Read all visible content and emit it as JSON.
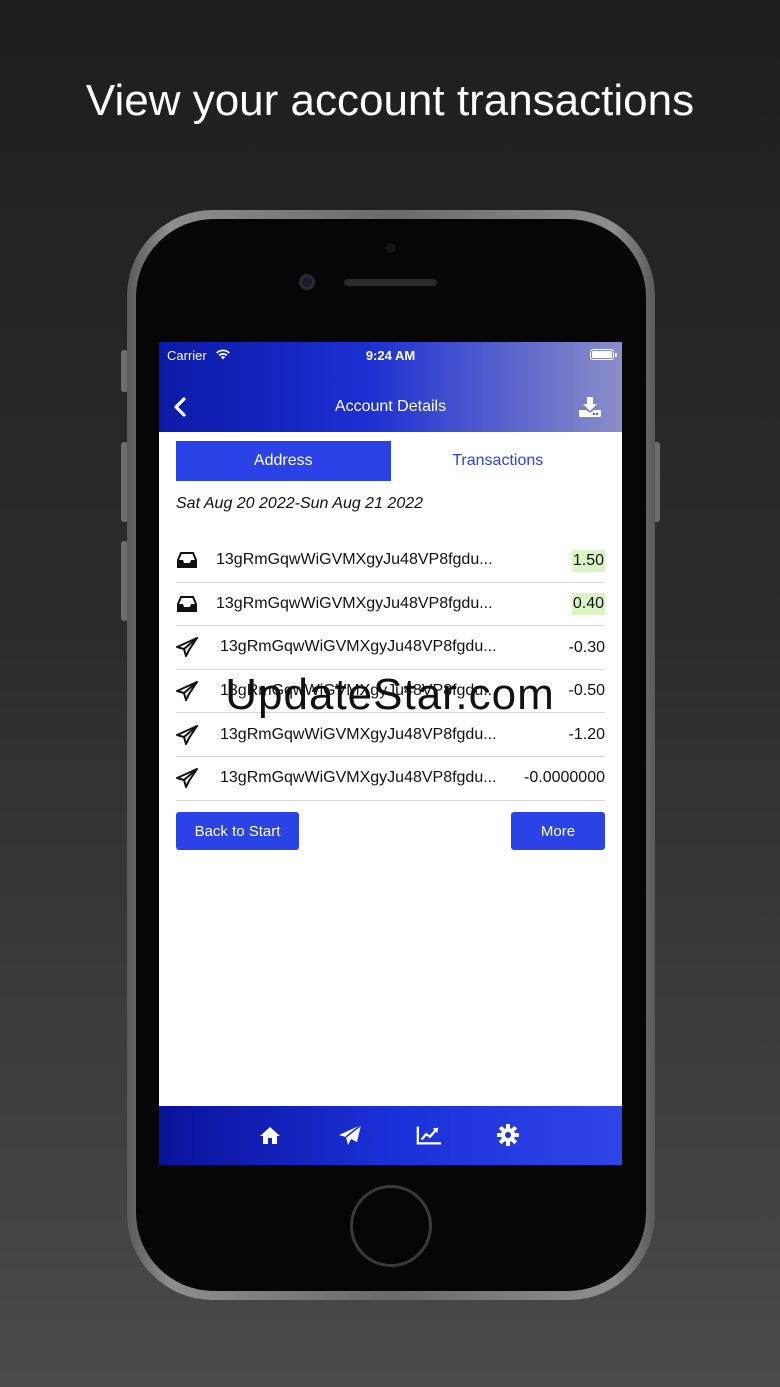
{
  "headline": "View your account transactions",
  "status_bar": {
    "carrier": "Carrier",
    "time": "9:24 AM"
  },
  "nav": {
    "title": "Account Details",
    "back_icon": "chevron-left-icon",
    "download_icon": "download-icon"
  },
  "segments": [
    {
      "label": "Address",
      "active": true
    },
    {
      "label": "Transactions",
      "active": false
    }
  ],
  "date_range": "Sat Aug 20 2022-Sun Aug 21 2022",
  "transactions": [
    {
      "type": "received",
      "icon": "inbox-icon",
      "address": "13gRmGqwWiGVMXgyJu48VP8fgdu...",
      "amount": "1.50"
    },
    {
      "type": "received",
      "icon": "inbox-icon",
      "address": "13gRmGqwWiGVMXgyJu48VP8fgdu...",
      "amount": "0.40"
    },
    {
      "type": "sent",
      "icon": "paper-plane-icon",
      "address": "13gRmGqwWiGVMXgyJu48VP8fgdu...",
      "amount": "-0.30"
    },
    {
      "type": "sent",
      "icon": "paper-plane-icon",
      "address": "13gRmGqwWiGVMXgyJu48VP8fgdu...",
      "amount": "-0.50"
    },
    {
      "type": "sent",
      "icon": "paper-plane-icon",
      "address": "13gRmGqwWiGVMXgyJu48VP8fgdu...",
      "amount": "-1.20"
    },
    {
      "type": "sent",
      "icon": "paper-plane-icon",
      "address": "13gRmGqwWiGVMXgyJu48VP8fgdu...",
      "amount": "-0.0000000"
    }
  ],
  "buttons": {
    "back_to_start": "Back to Start",
    "more": "More"
  },
  "tabbar": [
    "home-icon",
    "paper-plane-icon",
    "chart-line-icon",
    "gear-icon"
  ],
  "watermark": "UpdateStar.com",
  "colors": {
    "accent": "#2b43e6",
    "positive_highlight": "#d9f5c4",
    "nav_gradient_start": "#0b1aa6"
  }
}
